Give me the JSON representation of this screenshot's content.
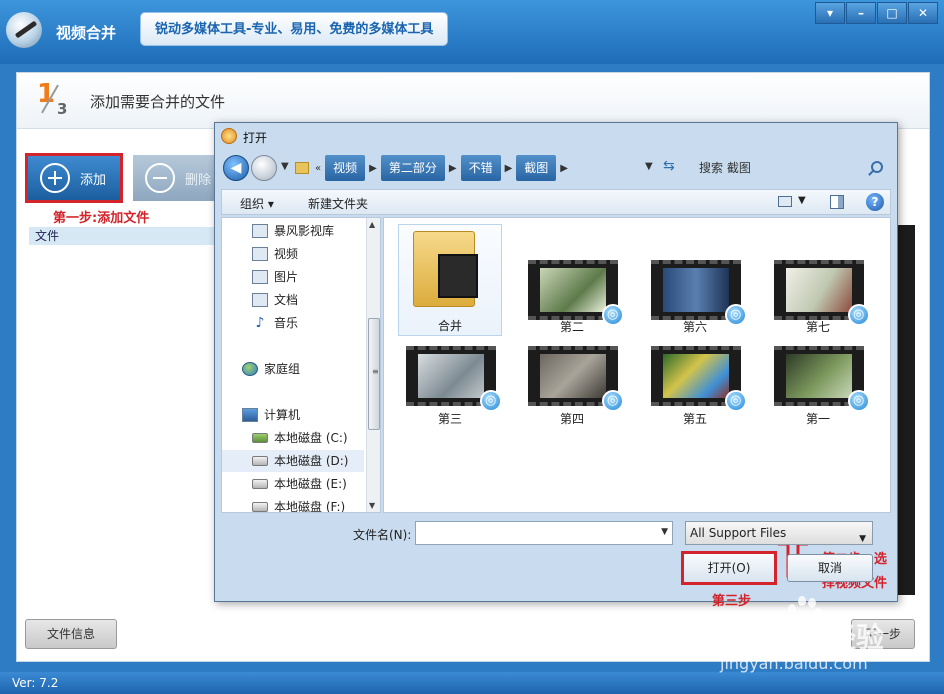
{
  "app": {
    "title": "视频合并",
    "slogan": "锐动多媒体工具-专业、易用、免费的多媒体工具",
    "version": "Ver: 7.2",
    "window_controls": [
      "▾",
      "–",
      "□",
      "✕"
    ]
  },
  "step": {
    "number": "1",
    "total": "3",
    "title": "添加需要合并的文件"
  },
  "toolbar": {
    "add_label": "添加",
    "delete_label": "删除",
    "step1_note": "第一步:添加文件",
    "file_column": "文件"
  },
  "footer": {
    "file_info_label": "文件信息",
    "next_label": "下一步"
  },
  "dialog": {
    "title": "打开",
    "address": [
      "视频",
      "第二部分",
      "不错",
      "截图"
    ],
    "search_placeholder": "搜索 截图",
    "organize_label": "组织 ▾",
    "new_folder_label": "新建文件夹",
    "nav_items": [
      {
        "label": "暴风影视库",
        "icon": "library-icon"
      },
      {
        "label": "视频",
        "icon": "video-icon"
      },
      {
        "label": "图片",
        "icon": "picture-icon"
      },
      {
        "label": "文档",
        "icon": "document-icon"
      },
      {
        "label": "音乐",
        "icon": "music-icon"
      },
      {
        "label": "家庭组",
        "icon": "homegroup-icon"
      },
      {
        "label": "计算机",
        "icon": "computer-icon"
      },
      {
        "label": "本地磁盘 (C:)",
        "icon": "drive-c-icon"
      },
      {
        "label": "本地磁盘 (D:)",
        "icon": "drive-icon"
      },
      {
        "label": "本地磁盘 (E:)",
        "icon": "drive-icon"
      },
      {
        "label": "本地磁盘 (F:)",
        "icon": "drive-icon"
      }
    ],
    "files": [
      "合并",
      "第二",
      "第六",
      "第七",
      "第三",
      "第四",
      "第五",
      "第一"
    ],
    "step2_note_line1": "第二步：选",
    "step2_note_line2": "择视频文件",
    "filename_label": "文件名(N):",
    "filename_value": "",
    "filetype": "All Support Files",
    "open_label": "打开(O)",
    "cancel_label": "取消",
    "step3_note": "第三步"
  },
  "watermark": {
    "brand": "Bai",
    "cn": "经验",
    "url": "jingyan.baidu.com"
  },
  "colors": {
    "accent_blue": "#2e7cc4",
    "annotation_red": "#d3232b",
    "step_orange": "#f07d1b"
  }
}
